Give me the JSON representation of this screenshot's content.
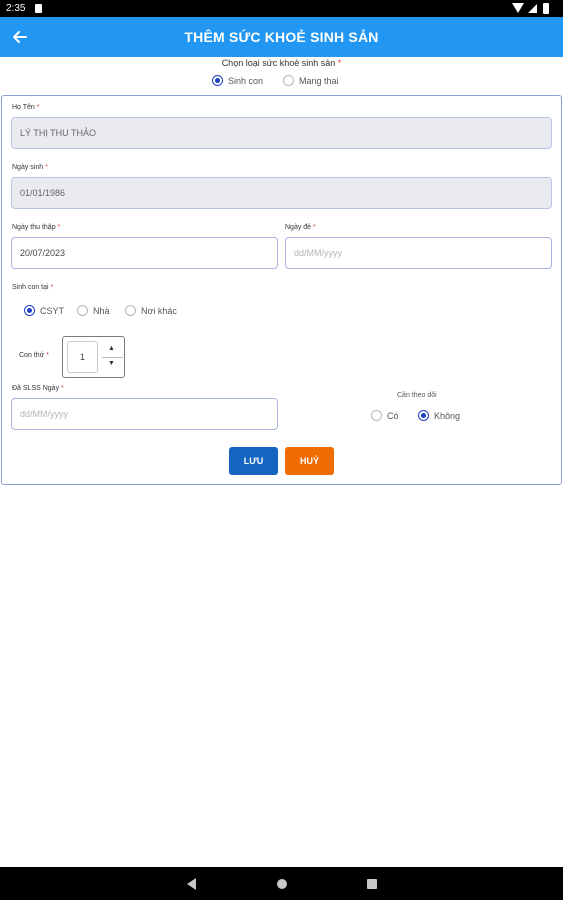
{
  "status_bar": {
    "time": "2:35"
  },
  "app_bar": {
    "title": "THÊM SỨC KHOẺ SINH SẢN"
  },
  "type_selector": {
    "label": "Chọn loại sức khoẻ sinh sản",
    "required_mark": "*",
    "options": [
      {
        "label": "Sinh con",
        "selected": true
      },
      {
        "label": "Mang thai",
        "selected": false
      }
    ]
  },
  "form": {
    "full_name": {
      "label": "Họ Tên",
      "required_mark": "*",
      "value": "LÝ THỊ THU THẢO"
    },
    "birth_date": {
      "label": "Ngày sinh",
      "required_mark": "*",
      "value": "01/01/1986"
    },
    "collect_date": {
      "label": "Ngày thu thập",
      "required_mark": "*",
      "value": "20/07/2023"
    },
    "delivery_date": {
      "label": "Ngày đẻ",
      "required_mark": "*",
      "placeholder": "dd/MM/yyyy"
    },
    "birth_place": {
      "label": "Sinh con tại",
      "required_mark": "*",
      "options": [
        {
          "label": "CSYT",
          "selected": true
        },
        {
          "label": "Nhà",
          "selected": false
        },
        {
          "label": "Nơi khác",
          "selected": false
        }
      ]
    },
    "child_order": {
      "label": "Con thứ",
      "required_mark": "*",
      "value": "1",
      "up_glyph": "▲",
      "down_glyph": "▼"
    },
    "birth_reg_date": {
      "label": "Đã SLSS Ngày",
      "required_mark": "*",
      "placeholder": "dd/MM/yyyy"
    },
    "monitoring": {
      "label": "Cần theo dõi",
      "options": [
        {
          "label": "Có",
          "selected": false
        },
        {
          "label": "Không",
          "selected": true
        }
      ]
    },
    "save_label": "LƯU",
    "cancel_label": "HUỶ"
  },
  "colors": {
    "app_bar": "#2196f3",
    "save_button": "#1565c0",
    "cancel_button": "#ef6c00",
    "radio_selected": "#1e40c8",
    "required_mark": "#e53935"
  },
  "icons": {
    "back": "arrow-left-icon",
    "nav_back": "triangle-back-icon",
    "nav_home": "circle-home-icon",
    "nav_recent": "square-recent-icon"
  }
}
